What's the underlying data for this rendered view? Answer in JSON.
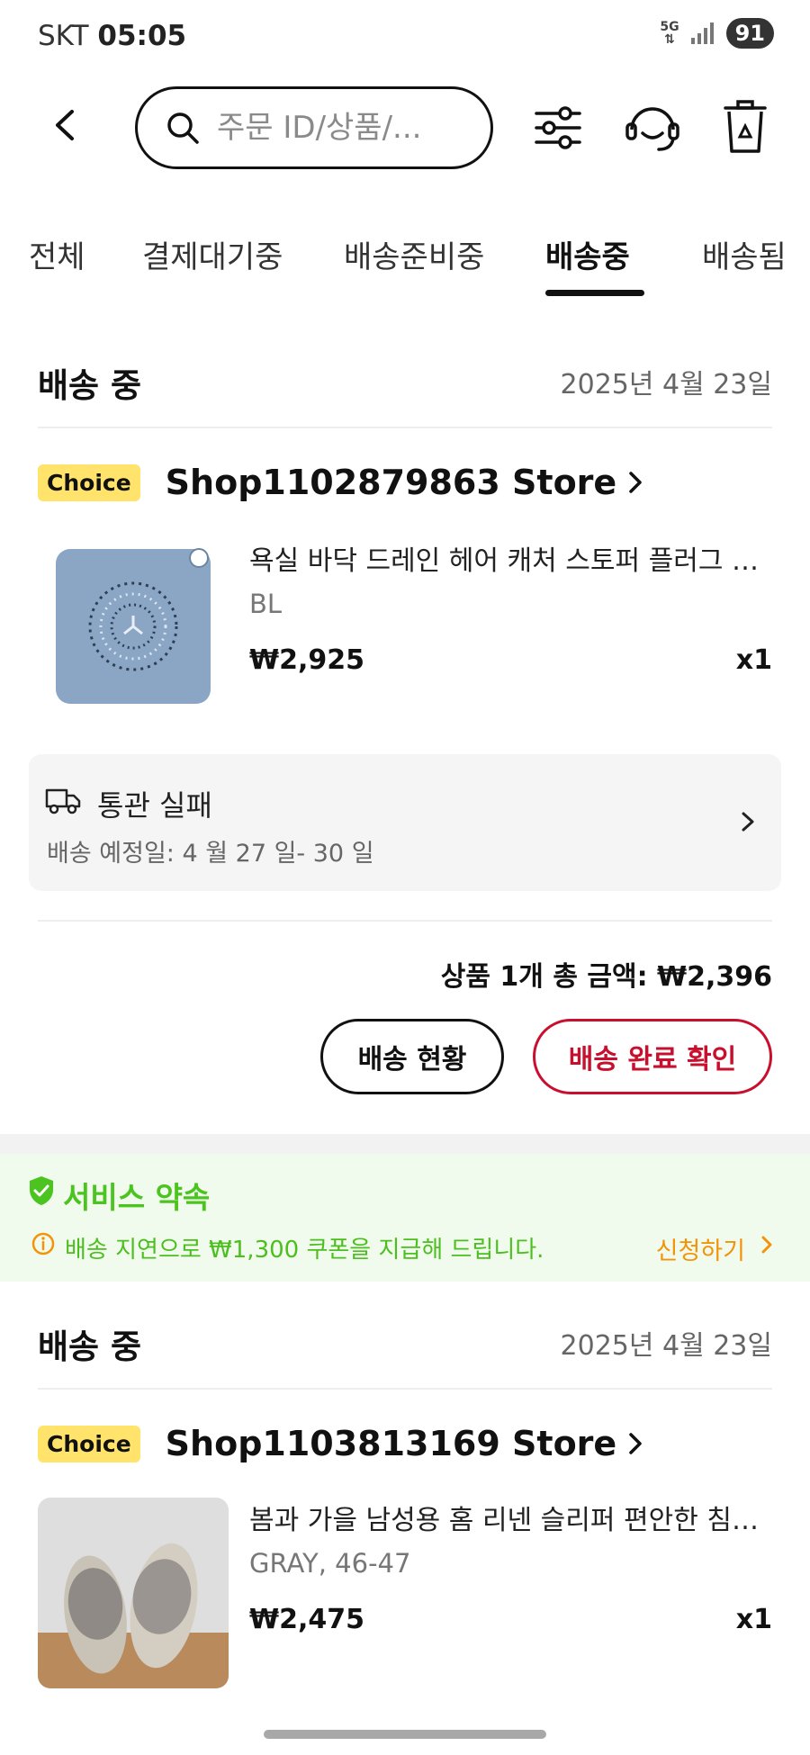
{
  "status_bar": {
    "carrier": "SKT",
    "time": "05:05",
    "network": "5G",
    "battery": "91"
  },
  "search": {
    "placeholder": "주문 ID/상품/..."
  },
  "tabs": [
    {
      "label": "전체"
    },
    {
      "label": "결제대기중"
    },
    {
      "label": "배송준비중"
    },
    {
      "label": "배송중"
    },
    {
      "label": "배송됨"
    }
  ],
  "active_tab": "배송중",
  "orders": [
    {
      "status": "배송 중",
      "date": "2025년 4월 23일",
      "badge": "Choice",
      "store": "Shop1102879863 Store",
      "product": {
        "title": "욕실 바닥 드레인 헤어 캐처 스토퍼 플러그 싱...",
        "variant": "BL",
        "price": "₩2,925",
        "qty": "x1"
      },
      "shipping": {
        "title": "통관 실패",
        "eta": "배송 예정일: 4 월 27 일- 30 일"
      },
      "total": "상품 1개 총 금액: ₩2,396",
      "track_label": "배송 현황",
      "confirm_label": "배송 완료 확인"
    },
    {
      "status": "배송 중",
      "date": "2025년 4월 23일",
      "badge": "Choice",
      "store": "Shop1103813169 Store",
      "product": {
        "title": "봄과 가을 남성용 홈 리넨 슬리퍼 편안한 침실 ...",
        "variant": "GRAY, 46-47",
        "price": "₩2,475",
        "qty": "x1"
      }
    }
  ],
  "service_promise": {
    "title": "서비스 약속",
    "message": "배송 지연으로 ₩1,300 쿠폰을 지급해 드립니다.",
    "apply_label": "신청하기"
  },
  "colors": {
    "accent_red": "#c8102e",
    "promise_green": "#4cc41f",
    "apply_orange": "#f2940a",
    "choice_yellow": "#ffe36b"
  },
  "icons": [
    "back-arrow-icon",
    "search-icon",
    "filter-icon",
    "customer-service-icon",
    "recycle-bin-icon",
    "truck-icon",
    "chevron-right-icon",
    "shield-check-icon",
    "info-icon"
  ]
}
